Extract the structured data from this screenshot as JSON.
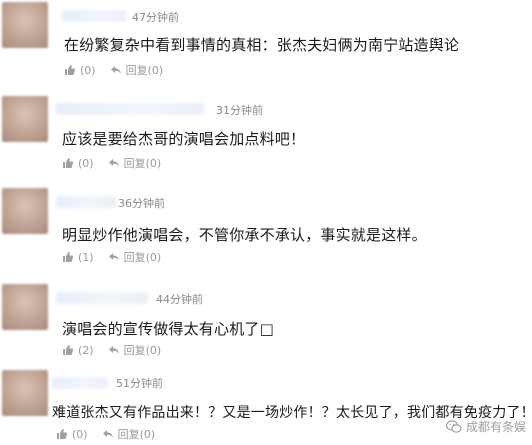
{
  "comments": [
    {
      "time": "47分钟前",
      "text": "在纷繁复杂中看到事情的真相：张杰夫妇俩为南宁站造舆论",
      "likes": "(0)",
      "reply": "回复(0)"
    },
    {
      "time": "31分钟前",
      "text": "应该是要给杰哥的演唱会加点料吧！",
      "likes": "(0)",
      "reply": "回复(0)"
    },
    {
      "time": "36分钟前",
      "text": "明显炒作他演唱会，不管你承不承认，事实就是这样。",
      "likes": "(1)",
      "reply": "回复(0)"
    },
    {
      "time": "44分钟前",
      "text": "演唱会的宣传做得太有心机了□",
      "likes": "(2)",
      "reply": "回复(0)"
    },
    {
      "time": "51分钟前",
      "text": "难道张杰又有作品出来！？又是一场炒作！？太长见了，我们都有免疫力了！",
      "likes": "(0)",
      "reply": "回复(0)"
    }
  ],
  "watermark": {
    "text": "成都有条娱",
    "icon": "wechat-icon"
  },
  "colors": {
    "text": "#1a1a1a",
    "meta": "#8a8a8a",
    "icon": "#9a9a9a"
  }
}
